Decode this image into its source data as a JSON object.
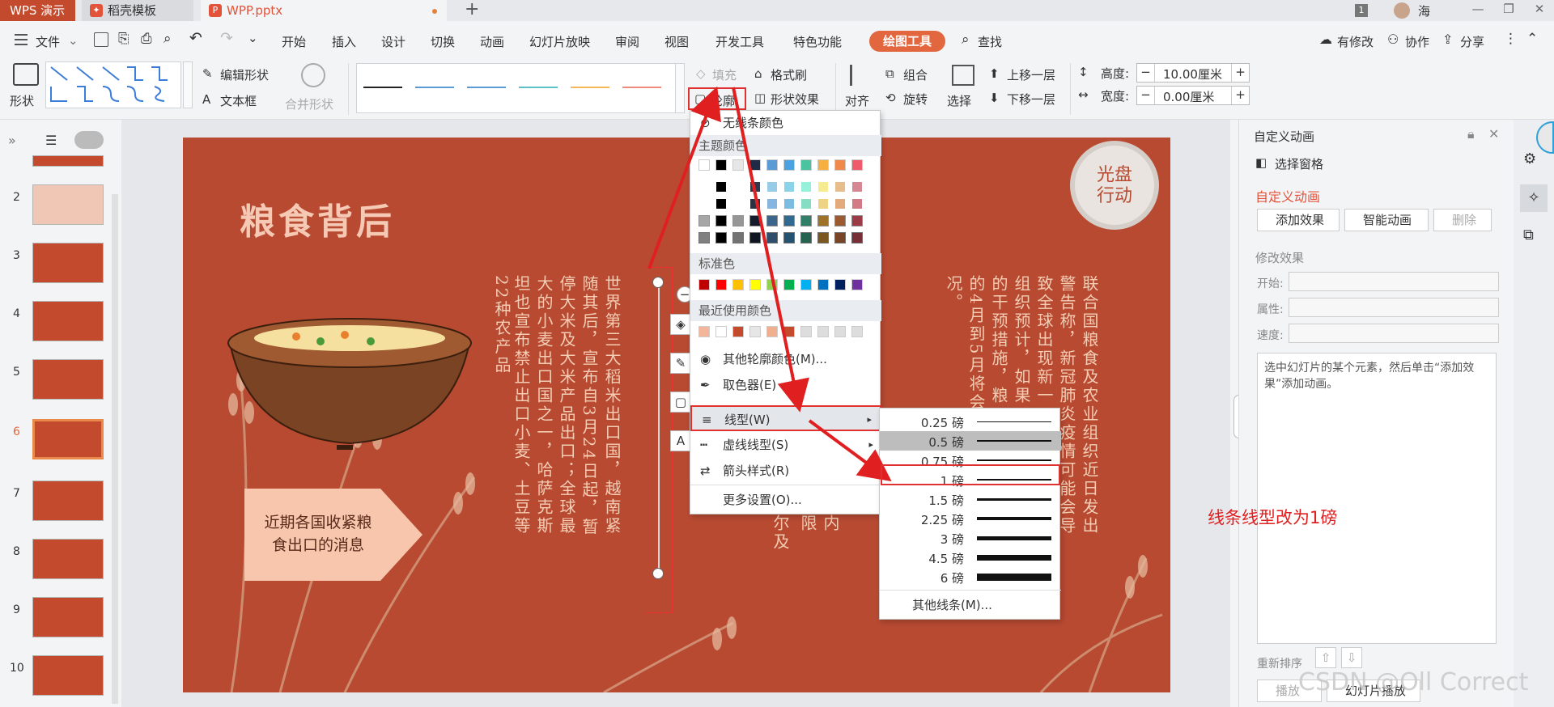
{
  "titlebar": {
    "app_tab": "WPS 演示",
    "tabs": [
      {
        "label": "稻壳模板"
      },
      {
        "label": "WPP.pptx"
      }
    ],
    "new_tab": "+",
    "badge": "1",
    "user": "海"
  },
  "menubar": {
    "file": "文件",
    "items": [
      "开始",
      "插入",
      "设计",
      "切换",
      "动画",
      "幻灯片放映",
      "审阅",
      "视图",
      "开发工具",
      "特色功能"
    ],
    "active_tool": "绘图工具",
    "search": "查找",
    "right": [
      "有修改",
      "协作",
      "分享"
    ]
  },
  "ribbon": {
    "shape_label": "形状",
    "edit_shape": "编辑形状",
    "textbox": "文本框",
    "merge_shape": "合并形状",
    "fill": "填充",
    "format_painter": "格式刷",
    "outline": "轮廓",
    "shape_effects": "形状效果",
    "align": "对齐",
    "group": "组合",
    "rotate": "旋转",
    "select": "选择",
    "bring_forward": "上移一层",
    "send_backward": "下移一层",
    "height_label": "高度:",
    "height_value": "10.00厘米",
    "width_label": "宽度:",
    "width_value": "0.00厘米",
    "line_colors": [
      "#222222",
      "#5b9bd5",
      "#5b9bd5",
      "#5bc0c8",
      "#f5b75a",
      "#f08a7a"
    ]
  },
  "thumbnails": {
    "numbers": [
      "2",
      "3",
      "4",
      "5",
      "6",
      "7",
      "8",
      "9",
      "10"
    ],
    "active": "6"
  },
  "slide": {
    "title": "粮食背后",
    "logo": "光盘行动",
    "tag": "近期各国收紧粮食出口的消息",
    "col_a": [
      "世界第三大稻米出口国，越南紧",
      "随其后，宣布自3月24日起，暂",
      "停大米及大米产品出口；全球最",
      "大的小麦出口国之一，哈萨克斯",
      "坦也宣布禁止出口小麦、土豆等",
      "22种农产品"
    ],
    "col_b": [
      "联合国粮食及农业组织近日发出",
      "警告称，新冠肺炎疫情可能会导",
      "致全球出现新一",
      "组织预计，如果",
      "的干预措施，粮",
      "的4月到5月将会",
      "况。"
    ],
    "partial": [
      "内",
      "限",
      "尔及"
    ]
  },
  "dropdown": {
    "no_line": "无线条颜色",
    "theme_colors": "主题颜色",
    "standard_colors": "标准色",
    "recent_colors": "最近使用颜色",
    "more_colors": "其他轮廓颜色(M)...",
    "eyedropper": "取色器(E)",
    "line_type": "线型(W)",
    "dash_type": "虚线线型(S)",
    "arrow_style": "箭头样式(R)",
    "more_settings": "更多设置(O)...",
    "theme_top": [
      "#ffffff",
      "#000000",
      "#e7e6e6",
      "#1f2a44",
      "#5b9bd5",
      "#4aa3df",
      "#4cc3a0",
      "#f5b041",
      "#f08a4b",
      "#f05b6b"
    ],
    "standard": [
      "#c00000",
      "#ff0000",
      "#ffc000",
      "#ffff00",
      "#92d050",
      "#00b050",
      "#00b0f0",
      "#0070c0",
      "#002060",
      "#7030a0"
    ],
    "recent": [
      "#f4b69a",
      "#ffffff",
      "#c34a2c",
      "#e6e6e6",
      "#f0b090",
      "#c34a2c",
      "#dddddd",
      "#dddddd",
      "#dddddd",
      "#dddddd"
    ]
  },
  "submenu": {
    "weights": [
      {
        "label": "0.25 磅",
        "w": 1
      },
      {
        "label": "0.5 磅",
        "w": 1.5
      },
      {
        "label": "0.75 磅",
        "w": 2
      },
      {
        "label": "1 磅",
        "w": 2.5
      },
      {
        "label": "1.5 磅",
        "w": 3
      },
      {
        "label": "2.25 磅",
        "w": 4
      },
      {
        "label": "3 磅",
        "w": 5
      },
      {
        "label": "4.5 磅",
        "w": 7
      },
      {
        "label": "6 磅",
        "w": 9
      }
    ],
    "more": "其他线条(M)..."
  },
  "rightpanel": {
    "header": "自定义动画",
    "select_pane": "选择窗格",
    "section": "自定义动画",
    "add_effect": "添加效果",
    "smart_anim": "智能动画",
    "delete": "删除",
    "modify": "修改效果",
    "start": "开始:",
    "prop": "属性:",
    "speed": "速度:",
    "hint": "选中幻灯片的某个元素，然后单击“添加效果”添加动画。",
    "reorder": "重新排序",
    "play": "播放",
    "slideshow": "幻灯片播放"
  },
  "annotation": "线条线型改为1磅",
  "watermark": "CSDN @Oll Correct"
}
